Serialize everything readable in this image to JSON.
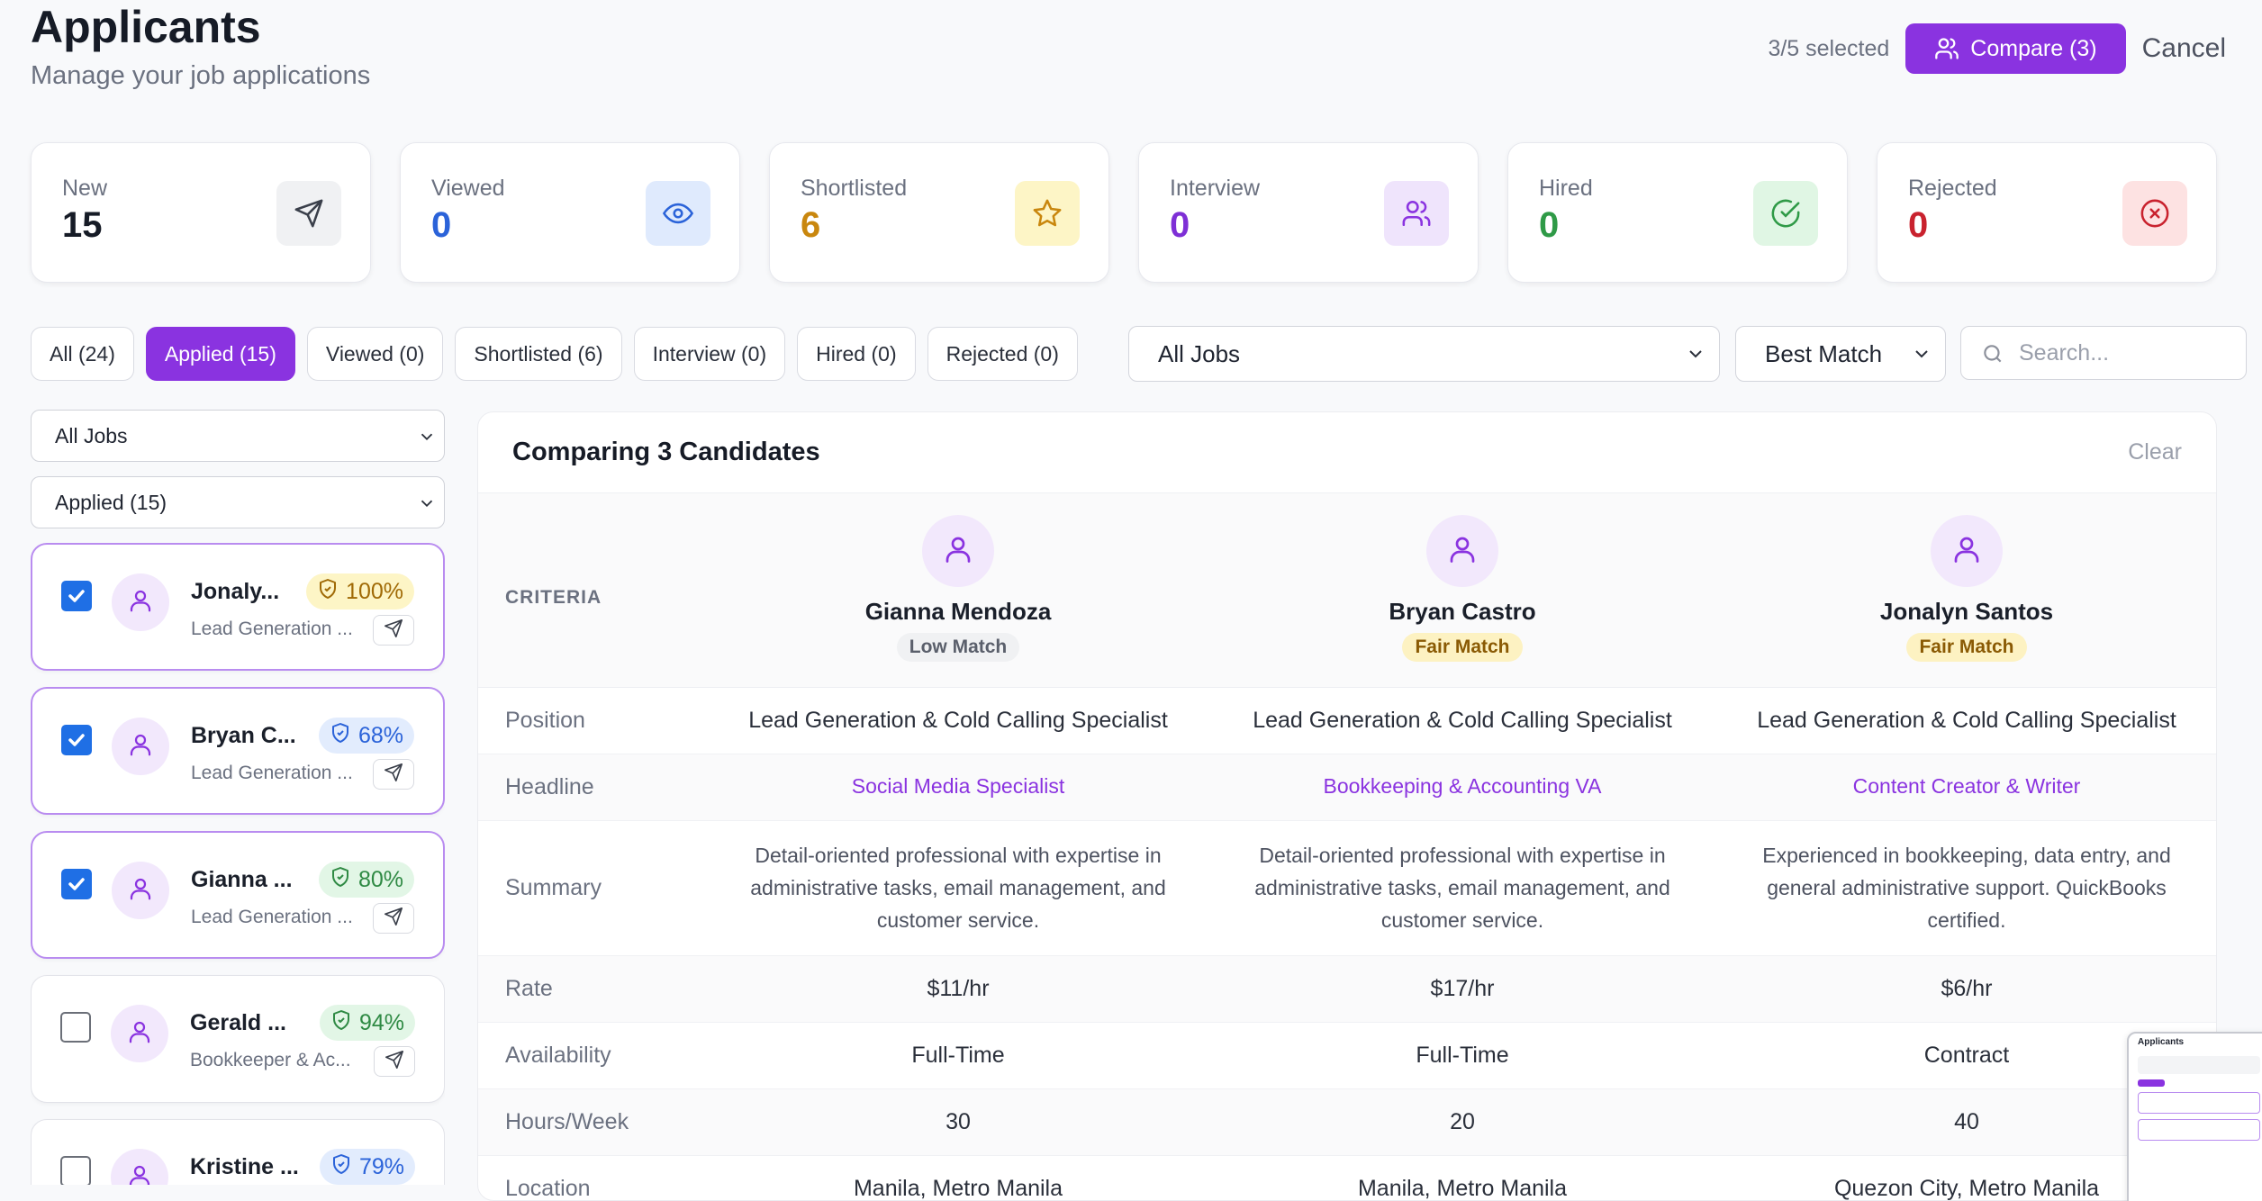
{
  "header": {
    "title": "Applicants",
    "subtitle": "Manage your job applications",
    "selected_count": "3/5 selected",
    "compare_label": "Compare (3)",
    "cancel_label": "Cancel"
  },
  "stats": [
    {
      "label": "New",
      "value": "15",
      "color": "#161b26",
      "icon": "send-icon",
      "icon_bg": "#f0f1f3"
    },
    {
      "label": "Viewed",
      "value": "0",
      "color": "#2b63d9",
      "icon": "eye-icon",
      "icon_bg": "#dfeafd"
    },
    {
      "label": "Shortlisted",
      "value": "6",
      "color": "#c9870e",
      "icon": "star-icon",
      "icon_bg": "#fdf5c6"
    },
    {
      "label": "Interview",
      "value": "0",
      "color": "#7e2fd6",
      "icon": "users-icon",
      "icon_bg": "#efe4fc"
    },
    {
      "label": "Hired",
      "value": "0",
      "color": "#2f9a47",
      "icon": "check-circle-icon",
      "icon_bg": "#e0f6e4"
    },
    {
      "label": "Rejected",
      "value": "0",
      "color": "#c9222e",
      "icon": "x-circle-icon",
      "icon_bg": "#fde2e2"
    }
  ],
  "tabs": [
    {
      "label": "All (24)",
      "active": false
    },
    {
      "label": "Applied (15)",
      "active": true
    },
    {
      "label": "Viewed (0)",
      "active": false
    },
    {
      "label": "Shortlisted (6)",
      "active": false
    },
    {
      "label": "Interview (0)",
      "active": false
    },
    {
      "label": "Hired (0)",
      "active": false
    },
    {
      "label": "Rejected (0)",
      "active": false
    }
  ],
  "jobs_select": "All Jobs",
  "sort_select": "Best Match",
  "search_placeholder": "Search...",
  "sidebar": {
    "job_filter": "All Jobs",
    "status_filter": "Applied (15)",
    "cards": [
      {
        "name": "Jonaly...",
        "role": "Lead Generation ...",
        "match": "100%",
        "checked": true,
        "badge_bg": "#fdf5c6",
        "badge_fg": "#a06a06"
      },
      {
        "name": "Bryan C...",
        "role": "Lead Generation ...",
        "match": "68%",
        "checked": true,
        "badge_bg": "#e2ecfd",
        "badge_fg": "#2b63d9"
      },
      {
        "name": "Gianna ...",
        "role": "Lead Generation ...",
        "match": "80%",
        "checked": true,
        "badge_bg": "#e2f6e6",
        "badge_fg": "#2f8a44"
      },
      {
        "name": "Gerald ...",
        "role": "Bookkeeper & Ac...",
        "match": "94%",
        "checked": false,
        "badge_bg": "#e2f6e6",
        "badge_fg": "#2f8a44"
      },
      {
        "name": "Kristine ...",
        "role": "",
        "match": "79%",
        "checked": false,
        "badge_bg": "#e2ecfd",
        "badge_fg": "#2b63d9"
      }
    ]
  },
  "comparison": {
    "title": "Comparing 3 Candidates",
    "clear_label": "Clear",
    "criteria_label": "CRITERIA",
    "candidates": [
      {
        "name": "Gianna Mendoza",
        "match": "Low Match",
        "match_bg": "#f0f1f3",
        "match_fg": "#5a5f6b"
      },
      {
        "name": "Bryan Castro",
        "match": "Fair Match",
        "match_bg": "#fdf2c2",
        "match_fg": "#8a5a04"
      },
      {
        "name": "Jonalyn Santos",
        "match": "Fair Match",
        "match_bg": "#fdf2c2",
        "match_fg": "#8a5a04"
      }
    ],
    "rows": [
      {
        "label": "Position",
        "values": [
          "Lead Generation & Cold Calling Specialist",
          "Lead Generation & Cold Calling Specialist",
          "Lead Generation & Cold Calling Specialist"
        ],
        "kind": "plain"
      },
      {
        "label": "Headline",
        "values": [
          "Social Media Specialist",
          "Bookkeeping & Accounting VA",
          "Content Creator & Writer"
        ],
        "kind": "link"
      },
      {
        "label": "Summary",
        "values": [
          "Detail-oriented professional with expertise in administrative tasks, email management, and customer service.",
          "Detail-oriented professional with expertise in administrative tasks, email management, and customer service.",
          "Experienced in bookkeeping, data entry, and general administrative support. QuickBooks certified."
        ],
        "kind": "sum"
      },
      {
        "label": "Rate",
        "values": [
          "$11/hr",
          "$17/hr",
          "$6/hr"
        ],
        "kind": "plain"
      },
      {
        "label": "Availability",
        "values": [
          "Full-Time",
          "Full-Time",
          "Contract"
        ],
        "kind": "plain"
      },
      {
        "label": "Hours/Week",
        "values": [
          "30",
          "20",
          "40"
        ],
        "kind": "plain"
      },
      {
        "label": "Location",
        "values": [
          "Manila, Metro Manila",
          "Manila, Metro Manila",
          "Quezon City, Metro Manila"
        ],
        "kind": "plain"
      }
    ]
  }
}
